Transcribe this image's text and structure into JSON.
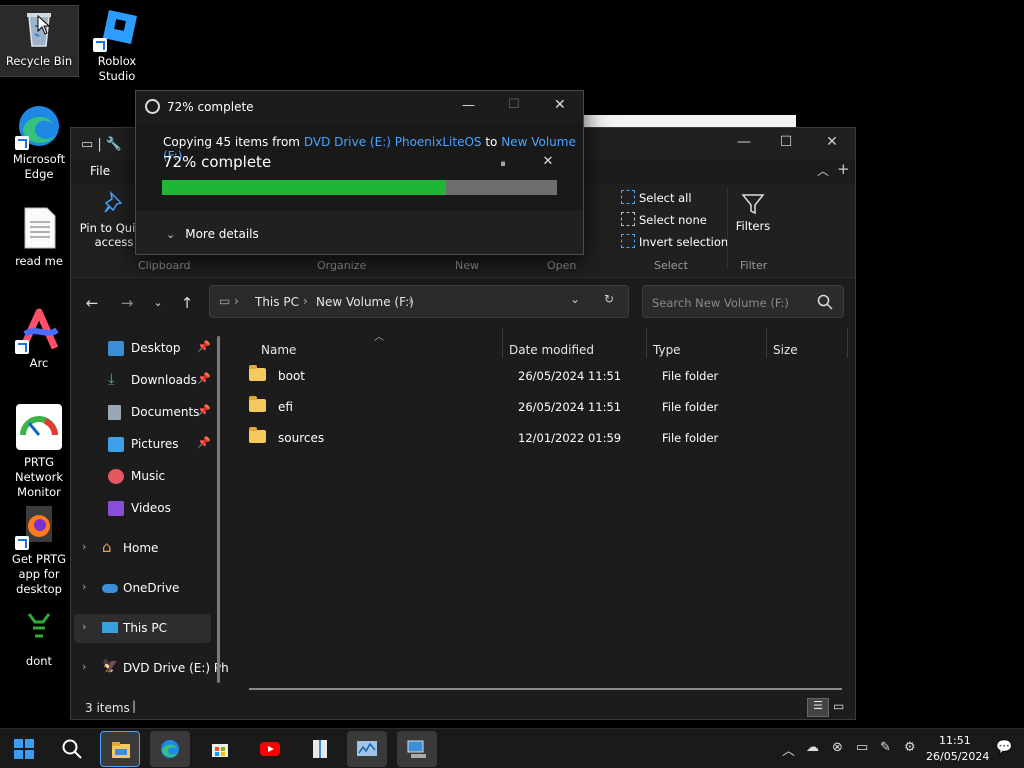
{
  "desktop": {
    "icons": [
      {
        "label": "Recycle Bin"
      },
      {
        "label": "Roblox Studio"
      },
      {
        "label": "Microsoft Edge"
      },
      {
        "label": "read me"
      },
      {
        "label": "Arc"
      },
      {
        "label": "PRTG Network Monitor"
      },
      {
        "label": "Get PRTG app for desktop"
      },
      {
        "label": "dont"
      }
    ]
  },
  "copy_dialog": {
    "title": "72% complete",
    "copying_prefix": "Copying 45 items from",
    "source": "DVD Drive (E:) PhoenixLiteOS",
    "to_word": "to",
    "destination": "New Volume (F:)",
    "percent_text": "72% complete",
    "progress": 0.72,
    "pause_icon": "⏸",
    "close_icon": "✕",
    "more_details": "More details",
    "progress_color": "#1db639"
  },
  "explorer": {
    "menu_file": "File",
    "ribbon": {
      "pin_label": "Pin to Quick access",
      "select_all": "Select all",
      "select_none": "Select none",
      "invert_selection": "Invert selection",
      "filters": "Filters",
      "groups": [
        "Clipboard",
        "Organize",
        "New",
        "Open",
        "Select",
        "Filter"
      ]
    },
    "address": {
      "segments": [
        "This PC",
        "New Volume (F:)"
      ],
      "search_placeholder": "Search New Volume (F:)"
    },
    "sidebar": [
      {
        "label": "Desktop",
        "pinned": true
      },
      {
        "label": "Downloads",
        "pinned": true
      },
      {
        "label": "Documents",
        "pinned": true
      },
      {
        "label": "Pictures",
        "pinned": true
      },
      {
        "label": "Music",
        "pinned": false
      },
      {
        "label": "Videos",
        "pinned": false
      },
      {
        "label": "Home",
        "pinned": false
      },
      {
        "label": "OneDrive",
        "pinned": false
      },
      {
        "label": "This PC",
        "pinned": false
      },
      {
        "label": "DVD Drive (E:) Ph",
        "pinned": false
      }
    ],
    "columns": [
      "Name",
      "Date modified",
      "Type",
      "Size"
    ],
    "files": [
      {
        "name": "boot",
        "date": "26/05/2024 11:51",
        "type": "File folder"
      },
      {
        "name": "efi",
        "date": "26/05/2024 11:51",
        "type": "File folder"
      },
      {
        "name": "sources",
        "date": "12/01/2022 01:59",
        "type": "File folder"
      }
    ],
    "status": "3 items"
  },
  "taskbar": {
    "time": "11:51",
    "date": "26/05/2024"
  }
}
